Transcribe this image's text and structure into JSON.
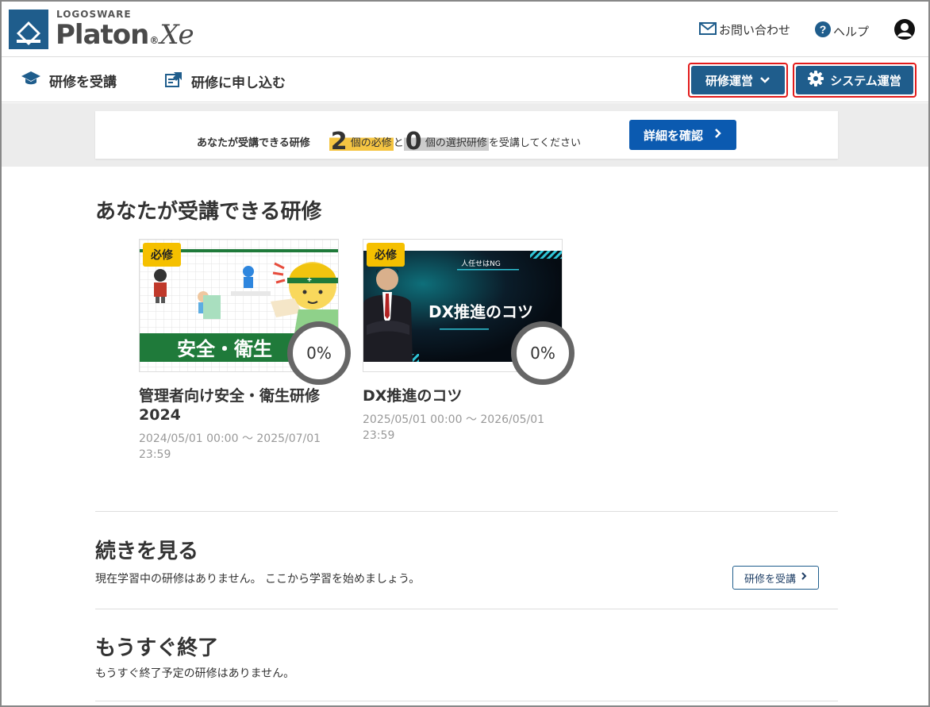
{
  "header": {
    "logo_sub": "LOGOSWARE",
    "logo_main": "Platon",
    "logo_reg": "®",
    "logo_xe": "Xe",
    "contact_label": "お問い合わせ",
    "help_label": "ヘルプ",
    "icons": {
      "contact": "mail-icon",
      "help": "help-circle-icon",
      "user": "user-avatar-icon"
    }
  },
  "nav": {
    "learn_label": "研修を受講",
    "apply_label": "研修に申し込む",
    "manage_label": "研修運営",
    "system_label": "システム運営",
    "icons": {
      "learn": "graduation-cap-icon",
      "apply": "apply-form-icon",
      "manage": "chevron-down-icon",
      "system": "gear-icon"
    }
  },
  "notice": {
    "lead": "あなたが受講できる研修",
    "required_count": "2",
    "required_label": "個の必修",
    "conj": "と",
    "elective_count": "0",
    "elective_label": "個の選択研修",
    "tail": "を受講してください",
    "button_label": "詳細を確認"
  },
  "available": {
    "title": "あなたが受講できる研修",
    "courses": [
      {
        "badge": "必修",
        "thumb_text": "安全・衛生",
        "progress": "0%",
        "title": "管理者向け安全・衛生研修2024",
        "date": "2024/05/01 00:00 ～ 2025/07/01 23:59"
      },
      {
        "badge": "必修",
        "thumb_caption": "人任せはNG",
        "thumb_text": "DX推進のコツ",
        "progress": "0%",
        "title": "DX推進のコツ",
        "date": "2025/05/01 00:00 ～ 2026/05/01 23:59"
      }
    ]
  },
  "continue": {
    "title": "続きを見る",
    "message": "現在学習中の研修はありません。 ここから学習を始めましょう。",
    "button_label": "研修を受講"
  },
  "ending": {
    "title": "もうすぐ終了",
    "message": "もうすぐ終了予定の研修はありません。"
  },
  "colors": {
    "brand": "#1f5d8c",
    "primary_button": "#0b5ab0",
    "highlight_red": "#e21b1b",
    "badge_yellow": "#f5c000",
    "band_gray": "#ececec"
  }
}
